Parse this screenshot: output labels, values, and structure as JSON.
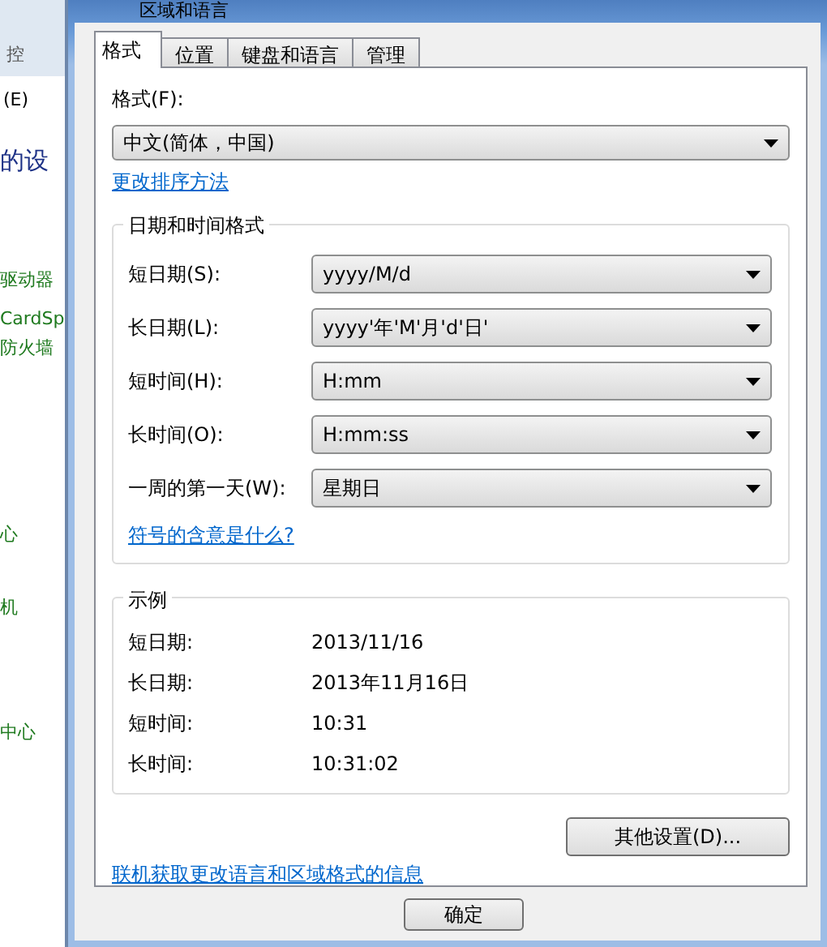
{
  "background_window": {
    "breadcrumb": "控",
    "menu": "(E)",
    "heading": "的设",
    "links": [
      "驱动器",
      "CardSp",
      "防火墙",
      "心",
      "机",
      "中心"
    ]
  },
  "window": {
    "title": "区域和语言"
  },
  "tabs": [
    {
      "label": "格式",
      "selected": true
    },
    {
      "label": "位置",
      "selected": false
    },
    {
      "label": "键盘和语言",
      "selected": false
    },
    {
      "label": "管理",
      "selected": false
    }
  ],
  "format": {
    "label": "格式(F):",
    "value": "中文(简体，中国)",
    "link": "更改排序方法"
  },
  "date_time_group": {
    "title": "日期和时间格式",
    "rows": [
      {
        "label": "短日期(S):",
        "value": "yyyy/M/d"
      },
      {
        "label": "长日期(L):",
        "value": "yyyy'年'M'月'd'日'"
      },
      {
        "label": "短时间(H):",
        "value": "H:mm"
      },
      {
        "label": "长时间(O):",
        "value": "H:mm:ss"
      },
      {
        "label": "一周的第一天(W):",
        "value": "星期日"
      }
    ],
    "link": "符号的含意是什么?"
  },
  "example_group": {
    "title": "示例",
    "rows": [
      {
        "label": "短日期:",
        "value": "2013/11/16"
      },
      {
        "label": "长日期:",
        "value": "2013年11月16日"
      },
      {
        "label": "短时间:",
        "value": "10:31"
      },
      {
        "label": "长时间:",
        "value": "10:31:02"
      }
    ]
  },
  "additional_settings_button": "其他设置(D)...",
  "online_link": "联机获取更改语言和区域格式的信息",
  "buttons": [
    "确定"
  ]
}
